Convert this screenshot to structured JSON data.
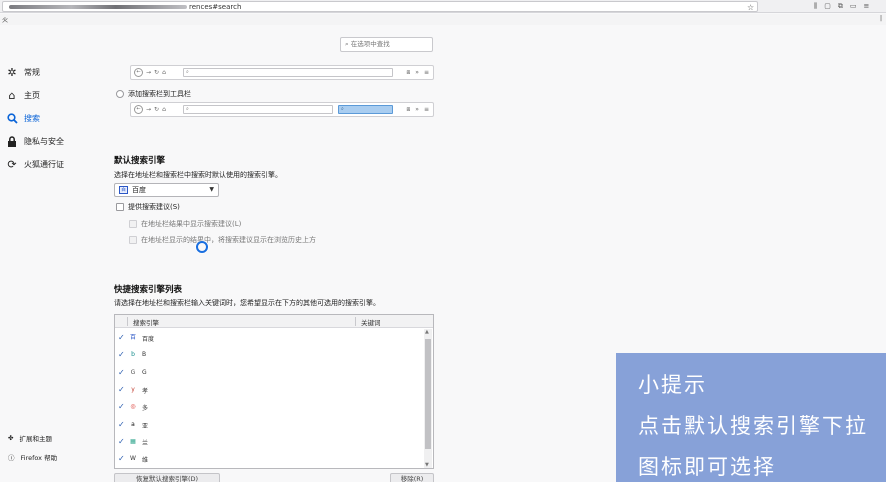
{
  "toolbar": {
    "url_suffix": "rences#search",
    "bookmark_left": "火",
    "bookmark_right": "|"
  },
  "sidebar": {
    "items": [
      {
        "label": "常规",
        "icon": "gear-icon"
      },
      {
        "label": "主页",
        "icon": "home-icon"
      },
      {
        "label": "搜索",
        "icon": "search-icon"
      },
      {
        "label": "隐私与安全",
        "icon": "lock-icon"
      },
      {
        "label": "火狐通行证",
        "icon": "sync-icon"
      }
    ],
    "footer": [
      {
        "label": "扩展和主题",
        "icon": "puzzle-icon"
      },
      {
        "label": "Firefox 帮助",
        "icon": "help-icon"
      }
    ]
  },
  "find": {
    "placeholder": "在选项中查找"
  },
  "search_bar_option": {
    "label": "添加搜索栏到工具栏"
  },
  "default_engine": {
    "heading": "默认搜索引擎",
    "description": "选择在地址栏和搜索栏中搜索时默认使用的搜索引擎。",
    "selected": "百度",
    "suggest_label": "提供搜索建议(S)",
    "suggest_in_bar": "在地址栏结果中显示搜索建议(L)",
    "suggest_above_history": "在地址栏显示的结果中，将搜索建议显示在浏览历史上方"
  },
  "shortcuts": {
    "heading": "快捷搜索引擎列表",
    "description": "请选择在地址栏和搜索栏输入关键词时，您希望显示在下方的其他可选用的搜索引擎。",
    "col_engine": "搜索引擎",
    "col_keyword": "关键词",
    "rows": [
      {
        "icon": "baidu-icon",
        "glyph": "百",
        "name": "百度",
        "color": "#2a56c6"
      },
      {
        "icon": "bing-icon",
        "glyph": "b",
        "name": "B",
        "color": "#138b8b"
      },
      {
        "icon": "google-icon",
        "glyph": "G",
        "name": "G",
        "color": "#555555"
      },
      {
        "icon": "yahoo-icon",
        "glyph": "y",
        "name": "孝",
        "color": "#c0392b"
      },
      {
        "icon": "engine-icon",
        "glyph": "◎",
        "name": "多",
        "color": "#d9322b"
      },
      {
        "icon": "amazon-icon",
        "glyph": "a",
        "name": "亚",
        "color": "#111111"
      },
      {
        "icon": "grid-icon",
        "glyph": "▦",
        "name": "兰",
        "color": "#2aa38a"
      },
      {
        "icon": "wikipedia-icon",
        "glyph": "W",
        "name": "维",
        "color": "#333333"
      }
    ],
    "restore_button": "恢复默认搜索引擎(D)",
    "remove_button": "移除(R)"
  },
  "tip": {
    "line1": "小提示",
    "line2": "点击默认搜索引擎下拉",
    "line3": "图标即可选择"
  }
}
